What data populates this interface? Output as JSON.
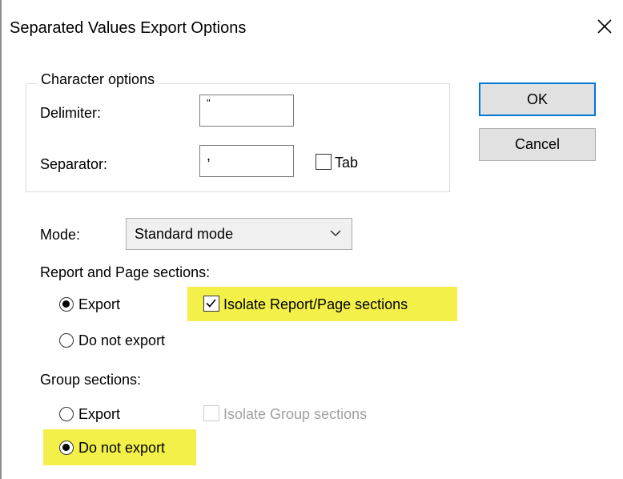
{
  "window": {
    "title": "Separated Values Export Options",
    "close_icon": "close-icon"
  },
  "character_options": {
    "group_label": "Character options",
    "delimiter_label": "Delimiter:",
    "delimiter_value": "\"",
    "separator_label": "Separator:",
    "separator_value": ",",
    "tab_label": "Tab",
    "tab_checked": false
  },
  "buttons": {
    "ok": "OK",
    "cancel": "Cancel"
  },
  "mode": {
    "label": "Mode:",
    "selected": "Standard mode"
  },
  "report_page_sections": {
    "label": "Report and Page sections:",
    "export_label": "Export",
    "do_not_export_label": "Do not export",
    "selected": "Export",
    "isolate_label": "Isolate Report/Page sections",
    "isolate_checked": true
  },
  "group_sections": {
    "label": "Group sections:",
    "export_label": "Export",
    "do_not_export_label": "Do not export",
    "selected": "Do not export",
    "isolate_label": "Isolate Group sections",
    "isolate_checked": false,
    "isolate_enabled": false
  },
  "colors": {
    "highlight": "#f3f04a",
    "default_button_border": "#0078d7",
    "disabled_text": "#a0a0a0"
  }
}
